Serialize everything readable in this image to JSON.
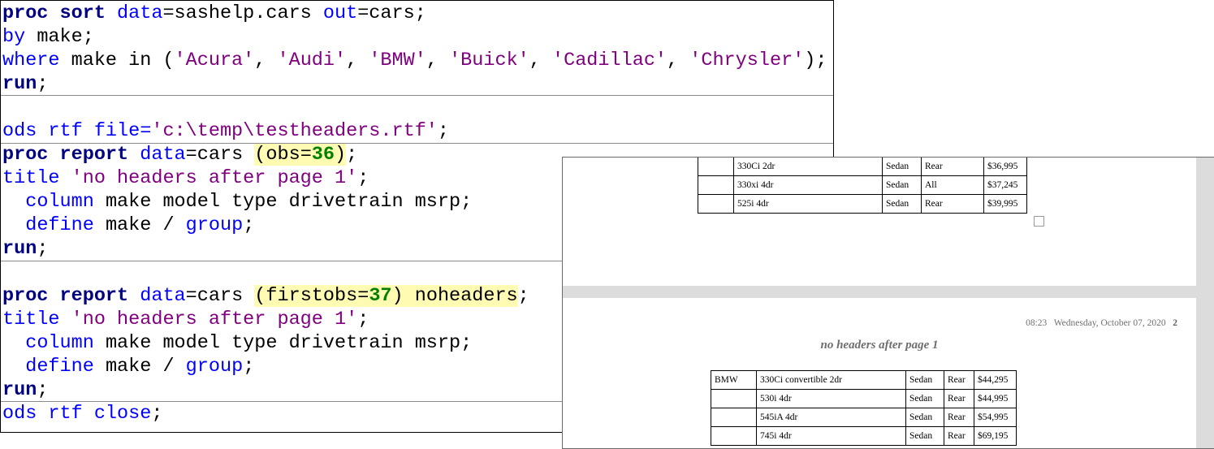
{
  "editor": {
    "line1": {
      "kw1": "proc sort",
      "a1": " data",
      "t1": "=sashelp.cars ",
      "a2": "out",
      "t2": "=cars;"
    },
    "line2": {
      "a1": "by",
      "t1": " make;"
    },
    "line3": {
      "a1": "where",
      "t1": " make in (",
      "s1": "'Acura'",
      "c1": ", ",
      "s2": "'Audi'",
      "c2": ", ",
      "s3": "'BMW'",
      "c3": ", ",
      "s4": "'Buick'",
      "c4": ", ",
      "s5": "'Cadillac'",
      "c5": ", ",
      "s6": "'Chrysler'",
      "t2": ");"
    },
    "line4": {
      "kw1": "run",
      "t1": ";"
    },
    "line6": {
      "a1": "ods rtf file=",
      "s1": "'c:\\temp\\testheaders.rtf'",
      "t1": ";"
    },
    "line7": {
      "kw1": "proc report",
      "a1": " data",
      "t1": "=cars ",
      "h1": "(obs=",
      "n1": "36",
      "h2": ")",
      "t2": ";"
    },
    "line8": {
      "a1": "title",
      "t1": " ",
      "s1": "'no headers after page 1'",
      "t2": ";"
    },
    "line9": {
      "i": "  ",
      "a1": "column",
      "t1": " make model type drivetrain msrp;"
    },
    "line10": {
      "i": "  ",
      "a1": "define",
      "t1": " make / ",
      "a2": "group",
      "t2": ";"
    },
    "line11": {
      "kw1": "run",
      "t1": ";"
    },
    "line13": {
      "kw1": "proc report",
      "a1": " data",
      "t1": "=cars ",
      "h1": "(firstobs=",
      "n1": "37",
      "h2": ") noheaders",
      "t2": ";"
    },
    "line14": {
      "a1": "title",
      "t1": " ",
      "s1": "'no headers after page 1'",
      "t2": ";"
    },
    "line15": {
      "i": "  ",
      "a1": "column",
      "t1": " make model type drivetrain msrp;"
    },
    "line16": {
      "i": "  ",
      "a1": "define",
      "t1": " make / ",
      "a2": "group",
      "t2": ";"
    },
    "line17": {
      "kw1": "run",
      "t1": ";"
    },
    "line18": {
      "a1": "ods rtf close",
      "t1": ";"
    }
  },
  "rtf": {
    "page1_rows": [
      {
        "make": "",
        "model": "330Ci 2dr",
        "type": "Sedan",
        "drive": "Rear",
        "msrp": "$36,995"
      },
      {
        "make": "",
        "model": "330xi 4dr",
        "type": "Sedan",
        "drive": "All",
        "msrp": "$37,245"
      },
      {
        "make": "",
        "model": "525i 4dr",
        "type": "Sedan",
        "drive": "Rear",
        "msrp": "$39,995"
      }
    ],
    "header_time": "08:23",
    "header_date": "Wednesday, October 07, 2020",
    "page_number": "2",
    "title": "no headers after page 1",
    "page2_rows": [
      {
        "make": "BMW",
        "model": "330Ci convertible 2dr",
        "type": "Sedan",
        "drive": "Rear",
        "msrp": "$44,295"
      },
      {
        "make": "",
        "model": "530i 4dr",
        "type": "Sedan",
        "drive": "Rear",
        "msrp": "$44,995"
      },
      {
        "make": "",
        "model": "545iA 4dr",
        "type": "Sedan",
        "drive": "Rear",
        "msrp": "$54,995"
      },
      {
        "make": "",
        "model": "745i 4dr",
        "type": "Sedan",
        "drive": "Rear",
        "msrp": "$69,195"
      }
    ]
  }
}
